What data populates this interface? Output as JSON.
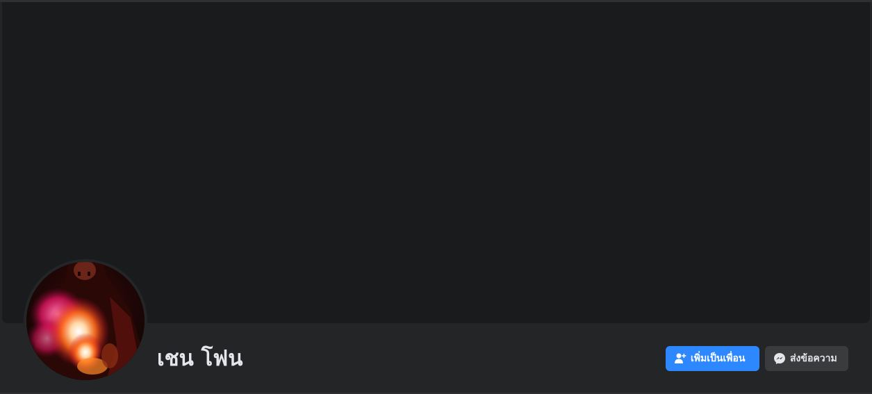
{
  "profile": {
    "name": "เชน โฟน"
  },
  "actions": {
    "add_friend_label": "เพิ่มเป็นเพื่อน",
    "message_label": "ส่งข้อความ"
  },
  "icons": {
    "add_friend": "add-friend-icon",
    "messenger": "messenger-icon"
  },
  "colors": {
    "background": "#242526",
    "cover": "#1a1b1d",
    "primary_button": "#2d88ff",
    "secondary_button": "#3a3b3c",
    "text": "#e4e6eb"
  }
}
